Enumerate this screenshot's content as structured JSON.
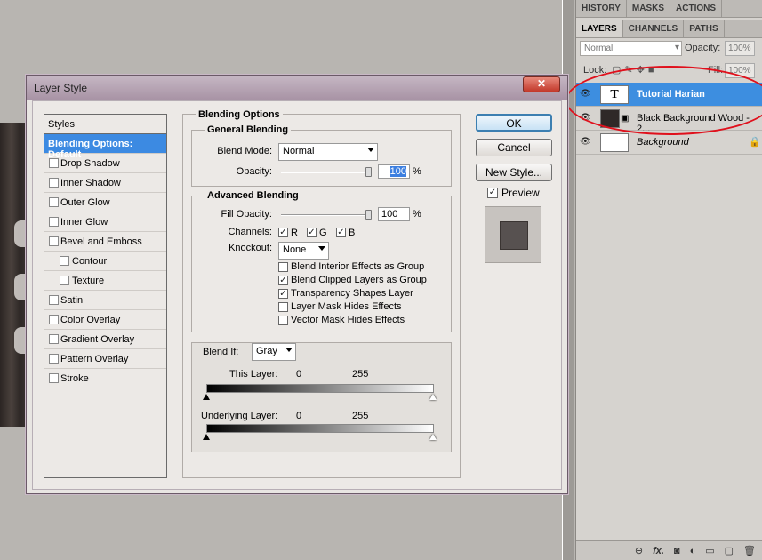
{
  "panel": {
    "tabs_row1": [
      "HISTORY",
      "MASKS",
      "ACTIONS"
    ],
    "tabs_row2": [
      "LAYERS",
      "CHANNELS",
      "PATHS"
    ],
    "blend_mode": "Normal",
    "opacity_label": "Opacity:",
    "opacity_value": "100%",
    "lock_label": "Lock:",
    "fill_label": "Fill:",
    "fill_value": "100%",
    "layers": [
      {
        "name": "Tutorial Harian",
        "thumb": "T",
        "selected": true
      },
      {
        "name": "Black Background Wood - 2...",
        "selected": false
      },
      {
        "name": "Background",
        "selected": false
      }
    ],
    "bottom_icons": [
      "link-icon",
      "fx-icon",
      "mask-icon",
      "adjustment-icon",
      "group-icon",
      "new-layer-icon",
      "trash-icon"
    ],
    "fx_label": "fx."
  },
  "dialog": {
    "title": "Layer Style",
    "close": "✕",
    "styles_header": "Styles",
    "styles": [
      {
        "label": "Blending Options: Default",
        "active": true
      },
      {
        "label": "Drop Shadow"
      },
      {
        "label": "Inner Shadow"
      },
      {
        "label": "Outer Glow"
      },
      {
        "label": "Inner Glow"
      },
      {
        "label": "Bevel and Emboss"
      },
      {
        "label": "Contour",
        "indent": true
      },
      {
        "label": "Texture",
        "indent": true
      },
      {
        "label": "Satin"
      },
      {
        "label": "Color Overlay"
      },
      {
        "label": "Gradient Overlay"
      },
      {
        "label": "Pattern Overlay"
      },
      {
        "label": "Stroke"
      }
    ],
    "blending_options": "Blending Options",
    "general_blending": "General Blending",
    "blend_mode_label": "Blend Mode:",
    "blend_mode_value": "Normal",
    "opacity_label": "Opacity:",
    "opacity_value": "100",
    "opacity_level": 1.0,
    "percent": "%",
    "advanced_blending": "Advanced Blending",
    "fill_opacity_label": "Fill Opacity:",
    "fill_opacity_value": "100",
    "channels_label": "Channels:",
    "channels": [
      "R",
      "G",
      "B"
    ],
    "knockout_label": "Knockout:",
    "knockout_value": "None",
    "options": [
      {
        "label": "Blend Interior Effects as Group",
        "checked": false
      },
      {
        "label": "Blend Clipped Layers as Group",
        "checked": true
      },
      {
        "label": "Transparency Shapes Layer",
        "checked": true
      },
      {
        "label": "Layer Mask Hides Effects",
        "checked": false
      },
      {
        "label": "Vector Mask Hides Effects",
        "checked": false
      }
    ],
    "blend_if_label": "Blend If:",
    "blend_if_value": "Gray",
    "this_layer_label": "This Layer:",
    "this_layer_low": "0",
    "this_layer_high": "255",
    "underlying_label": "Underlying Layer:",
    "underlying_low": "0",
    "underlying_high": "255",
    "ok": "OK",
    "cancel": "Cancel",
    "new_style": "New Style...",
    "preview_label": "Preview",
    "preview_checked": true
  }
}
